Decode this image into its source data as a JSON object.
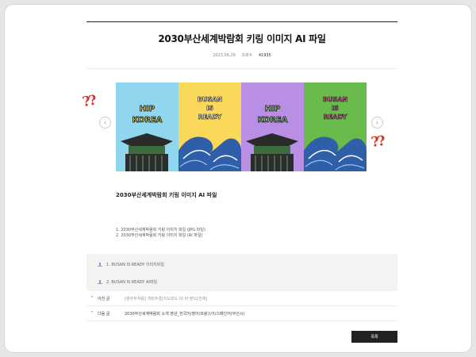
{
  "post": {
    "title": "2030부산세계박람회 키링 이미지 AI 파일",
    "date": "2023.06.29",
    "views_label": "조회수",
    "views": "41935",
    "subheading": "2030부산세계박람회 키링 이미지 AI 파일",
    "list_items": [
      "1. 2030부산세계박람회 키링 이미지 파일 (JPG 파일)",
      "2. 2030부산세계박람회 키링 이미지 파일 (AI 파일)"
    ]
  },
  "slides": [
    {
      "text_line1": "HIP",
      "text_line2": "KOREA",
      "bg": "#8fd6ee",
      "icon": "hip-korea-gate-icon"
    },
    {
      "text_line1": "BUSAN",
      "text_line2": "IS",
      "text_line3": "READY",
      "bg": "#f9d85a",
      "icon": "busan-wave-icon"
    },
    {
      "text_line1": "HIP",
      "text_line2": "KOREA",
      "bg": "#b98fe6",
      "icon": "hip-korea-gate-icon"
    },
    {
      "text_line1": "BUSAN",
      "text_line2": "IS",
      "text_line3": "READY",
      "bg": "#69bc4b",
      "icon": "busan-wave-icon"
    }
  ],
  "decor": {
    "qmarks": "??"
  },
  "attachments": [
    {
      "label": "1. BUSAN IS READY 이미지파일"
    },
    {
      "label": "2. BUSAN IS READY AI파일"
    }
  ],
  "nav": {
    "prev_label": "이전 글",
    "prev_text": "[행부부처럼] 개최주경[지도와도 ID 바 랜드[전체]",
    "next_label": "다음 글",
    "next_text": "2030부산세계박람회 소개 영상_한국어/영어/프랑스어/스페인어(부산시)"
  },
  "list_button": "목록",
  "colors": {
    "accent": "#222222",
    "qmark": "#d9332a"
  }
}
